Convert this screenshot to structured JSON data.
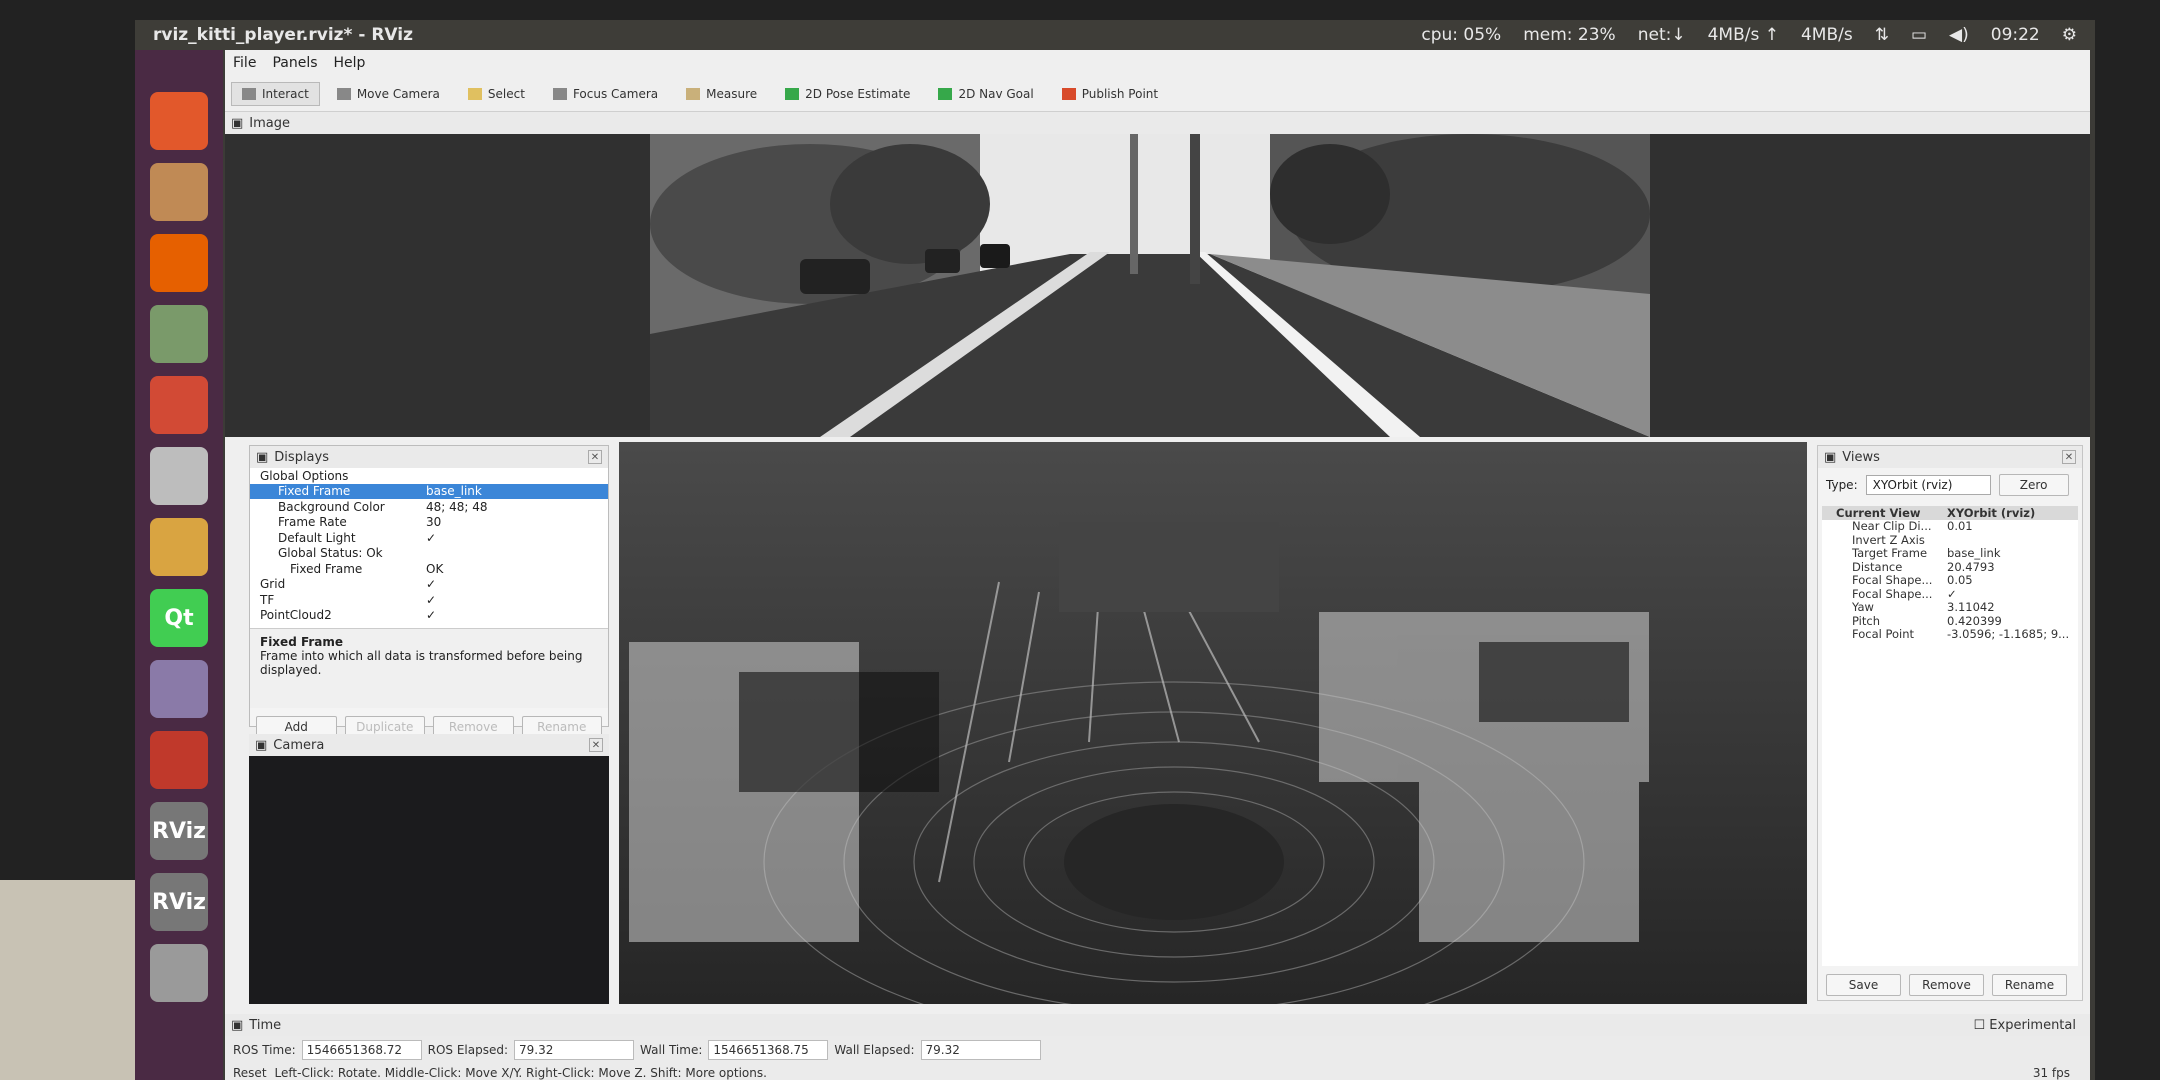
{
  "window": {
    "title": "rviz_kitti_player.rviz* - RViz"
  },
  "system": {
    "cpu": "cpu: 05%",
    "mem": "mem: 23%",
    "net": "net:↓",
    "up": "4MB/s ↑",
    "down": "4MB/s",
    "time": "09:22"
  },
  "menu": [
    "File",
    "Panels",
    "Help"
  ],
  "toolbar": [
    {
      "label": "Interact",
      "icon": "interact-icon"
    },
    {
      "label": "Move Camera",
      "icon": "move-camera-icon"
    },
    {
      "label": "Select",
      "icon": "select-icon"
    },
    {
      "label": "Focus Camera",
      "icon": "focus-camera-icon"
    },
    {
      "label": "Measure",
      "icon": "measure-icon"
    },
    {
      "label": "2D Pose Estimate",
      "icon": "pose-estimate-icon"
    },
    {
      "label": "2D Nav Goal",
      "icon": "nav-goal-icon"
    },
    {
      "label": "Publish Point",
      "icon": "publish-point-icon"
    }
  ],
  "image_panel": {
    "title": "Image"
  },
  "displays": {
    "title": "Displays",
    "rows": [
      {
        "k": "Global Options",
        "v": ""
      },
      {
        "k": "Fixed Frame",
        "v": "base_link"
      },
      {
        "k": "Background Color",
        "v": "48; 48; 48"
      },
      {
        "k": "Frame Rate",
        "v": "30"
      },
      {
        "k": "Default Light",
        "v": "✓"
      },
      {
        "k": "Global Status: Ok",
        "v": ""
      },
      {
        "k": "Fixed Frame",
        "v": "OK"
      },
      {
        "k": "Grid",
        "v": "✓"
      },
      {
        "k": "TF",
        "v": "✓"
      },
      {
        "k": "PointCloud2",
        "v": "✓"
      }
    ],
    "desc_title": "Fixed Frame",
    "desc_text": "Frame into which all data is transformed before being displayed.",
    "buttons": [
      "Add",
      "Duplicate",
      "Remove",
      "Rename"
    ]
  },
  "camera_panel": {
    "title": "Camera"
  },
  "views": {
    "title": "Views",
    "type_label": "Type:",
    "type_value": "XYOrbit (rviz)",
    "zero": "Zero",
    "current_view": "Current View",
    "current_view_type": "XYOrbit (rviz)",
    "rows": [
      {
        "k": "Near Clip Di...",
        "v": "0.01"
      },
      {
        "k": "Invert Z Axis",
        "v": ""
      },
      {
        "k": "Target Frame",
        "v": "base_link"
      },
      {
        "k": "Distance",
        "v": "20.4793"
      },
      {
        "k": "Focal Shape...",
        "v": "0.05"
      },
      {
        "k": "Focal Shape...",
        "v": "✓"
      },
      {
        "k": "Yaw",
        "v": "3.11042"
      },
      {
        "k": "Pitch",
        "v": "0.420399"
      },
      {
        "k": "Focal Point",
        "v": "-3.0596; -1.1685; 9..."
      }
    ],
    "buttons": [
      "Save",
      "Remove",
      "Rename"
    ]
  },
  "time": {
    "title": "Time",
    "ros_time_label": "ROS Time:",
    "ros_time": "1546651368.72",
    "ros_elapsed_label": "ROS Elapsed:",
    "ros_elapsed": "79.32",
    "wall_time_label": "Wall Time:",
    "wall_time": "1546651368.75",
    "wall_elapsed_label": "Wall Elapsed:",
    "wall_elapsed": "79.32",
    "experimental": "Experimental",
    "reset": "Reset",
    "hint": "Left-Click: Rotate. Middle-Click: Move X/Y. Right-Click: Move Z. Shift: More options.",
    "fps": "31 fps"
  },
  "launcher": [
    {
      "name": "dash-icon",
      "color": "#e2582b",
      "glyph": ""
    },
    {
      "name": "files-icon",
      "color": "#c08a55",
      "glyph": ""
    },
    {
      "name": "firefox-icon",
      "color": "#e66000",
      "glyph": ""
    },
    {
      "name": "wechat-icon",
      "color": "#7a9a6a",
      "glyph": ""
    },
    {
      "name": "chrome-icon",
      "color": "#d24a35",
      "glyph": ""
    },
    {
      "name": "calculator-icon",
      "color": "#bdbdbd",
      "glyph": ""
    },
    {
      "name": "archive-icon",
      "color": "#d9a441",
      "glyph": ""
    },
    {
      "name": "qt-icon",
      "color": "#41cd52",
      "glyph": "Qt"
    },
    {
      "name": "software-icon",
      "color": "#8a7aa8",
      "glyph": ""
    },
    {
      "name": "monitor-icon",
      "color": "#c0392b",
      "glyph": ""
    },
    {
      "name": "rviz-icon",
      "color": "#777777",
      "glyph": "RViz"
    },
    {
      "name": "rviz-icon-2",
      "color": "#777777",
      "glyph": "RViz"
    },
    {
      "name": "drive-icon",
      "color": "#9a9a9a",
      "glyph": ""
    }
  ]
}
